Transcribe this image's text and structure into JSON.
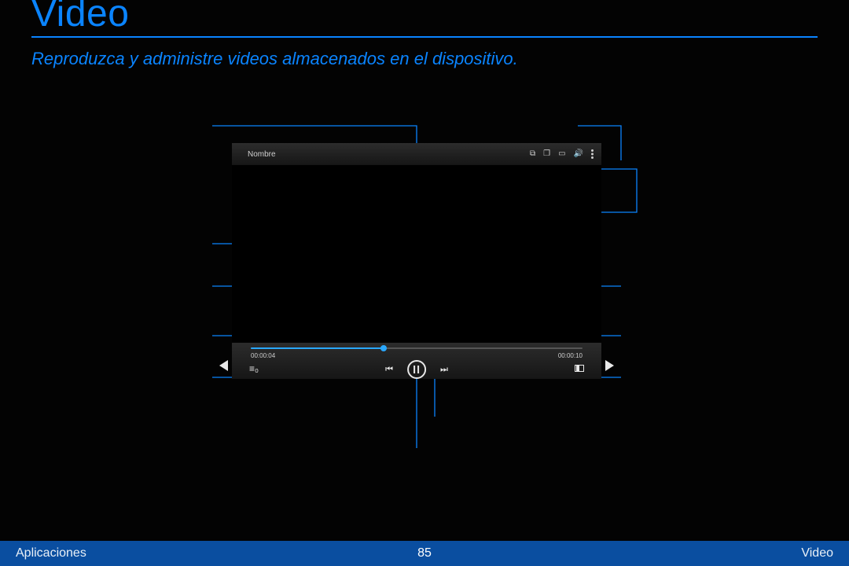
{
  "header": {
    "title": "Video",
    "subtitle": "Reproduzca y administre videos almacenados en el dispositivo."
  },
  "player": {
    "title_label": "Nombre",
    "time_elapsed": "00:00:04",
    "time_total": "00:00:10",
    "progress_pct": 40,
    "icons": {
      "screen_mirror": "screen-mirror-icon",
      "pip": "pip-icon",
      "ratio": "aspect-ratio-icon",
      "volume": "volume-icon",
      "more": "more-icon",
      "rewind": "rewind-icon",
      "forward": "fast-forward-icon",
      "pause": "pause-icon",
      "playlist": "playlist-icon",
      "crop": "crop-fill-icon",
      "prev": "previous-clip-icon",
      "next": "next-clip-icon"
    }
  },
  "footer": {
    "left": "Aplicaciones",
    "page": "85",
    "right": "Video"
  },
  "colors": {
    "accent": "#0a84ff",
    "footer_bg": "#0a4ea0"
  }
}
